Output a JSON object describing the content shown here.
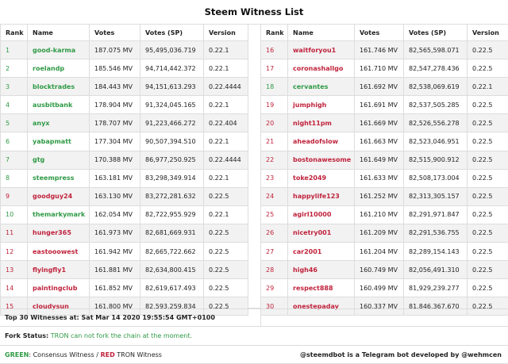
{
  "title": "Steem Witness List",
  "headers": [
    "Rank",
    "Name",
    "Votes",
    "Votes (SP)",
    "Version"
  ],
  "left": [
    {
      "rank": "1",
      "name": "good-karma",
      "votes": "187.075 MV",
      "sp": "95,495,036.719",
      "version": "0.22.1",
      "color": "green"
    },
    {
      "rank": "2",
      "name": "roelandp",
      "votes": "185.546 MV",
      "sp": "94,714,442.372",
      "version": "0.22.1",
      "color": "green"
    },
    {
      "rank": "3",
      "name": "blocktrades",
      "votes": "184.443 MV",
      "sp": "94,151,613.293",
      "version": "0.22.4444",
      "color": "green"
    },
    {
      "rank": "4",
      "name": "ausbitbank",
      "votes": "178.904 MV",
      "sp": "91,324,045.165",
      "version": "0.22.1",
      "color": "green"
    },
    {
      "rank": "5",
      "name": "anyx",
      "votes": "178.707 MV",
      "sp": "91,223,466.272",
      "version": "0.22.404",
      "color": "green"
    },
    {
      "rank": "6",
      "name": "yabapmatt",
      "votes": "177.304 MV",
      "sp": "90,507,394.510",
      "version": "0.22.1",
      "color": "green"
    },
    {
      "rank": "7",
      "name": "gtg",
      "votes": "170.388 MV",
      "sp": "86,977,250.925",
      "version": "0.22.4444",
      "color": "green"
    },
    {
      "rank": "8",
      "name": "steempress",
      "votes": "163.181 MV",
      "sp": "83,298,349.914",
      "version": "0.22.1",
      "color": "green"
    },
    {
      "rank": "9",
      "name": "goodguy24",
      "votes": "163.130 MV",
      "sp": "83,272,281.632",
      "version": "0.22.5",
      "color": "red"
    },
    {
      "rank": "10",
      "name": "themarkymark",
      "votes": "162.054 MV",
      "sp": "82,722,955.929",
      "version": "0.22.1",
      "color": "green"
    },
    {
      "rank": "11",
      "name": "hunger365",
      "votes": "161.973 MV",
      "sp": "82,681,669.931",
      "version": "0.22.5",
      "color": "red"
    },
    {
      "rank": "12",
      "name": "eastooowest",
      "votes": "161.942 MV",
      "sp": "82,665,722.662",
      "version": "0.22.5",
      "color": "red"
    },
    {
      "rank": "13",
      "name": "flyingfly1",
      "votes": "161.881 MV",
      "sp": "82,634,800.415",
      "version": "0.22.5",
      "color": "red"
    },
    {
      "rank": "14",
      "name": "paintingclub",
      "votes": "161.852 MV",
      "sp": "82,619,617.493",
      "version": "0.22.5",
      "color": "red"
    },
    {
      "rank": "15",
      "name": "cloudysun",
      "votes": "161.800 MV",
      "sp": "82,593,259.834",
      "version": "0.22.5",
      "color": "red"
    }
  ],
  "right": [
    {
      "rank": "16",
      "name": "waitforyou1",
      "votes": "161.746 MV",
      "sp": "82,565,598.071",
      "version": "0.22.5",
      "color": "red"
    },
    {
      "rank": "17",
      "name": "coronashallgo",
      "votes": "161.710 MV",
      "sp": "82,547,278.436",
      "version": "0.22.5",
      "color": "red"
    },
    {
      "rank": "18",
      "name": "cervantes",
      "votes": "161.692 MV",
      "sp": "82,538,069.619",
      "version": "0.22.1",
      "color": "green"
    },
    {
      "rank": "19",
      "name": "jumphigh",
      "votes": "161.691 MV",
      "sp": "82,537,505.285",
      "version": "0.22.5",
      "color": "red"
    },
    {
      "rank": "20",
      "name": "night11pm",
      "votes": "161.669 MV",
      "sp": "82,526,556.278",
      "version": "0.22.5",
      "color": "red"
    },
    {
      "rank": "21",
      "name": "aheadofslow",
      "votes": "161.663 MV",
      "sp": "82,523,046.951",
      "version": "0.22.5",
      "color": "red"
    },
    {
      "rank": "22",
      "name": "bostonawesome",
      "votes": "161.649 MV",
      "sp": "82,515,900.912",
      "version": "0.22.5",
      "color": "red"
    },
    {
      "rank": "23",
      "name": "toke2049",
      "votes": "161.633 MV",
      "sp": "82,508,173.004",
      "version": "0.22.5",
      "color": "red"
    },
    {
      "rank": "24",
      "name": "happylife123",
      "votes": "161.252 MV",
      "sp": "82,313,305.157",
      "version": "0.22.5",
      "color": "red"
    },
    {
      "rank": "25",
      "name": "agirl10000",
      "votes": "161.210 MV",
      "sp": "82,291,971.847",
      "version": "0.22.5",
      "color": "red"
    },
    {
      "rank": "26",
      "name": "nicetry001",
      "votes": "161.209 MV",
      "sp": "82,291,536.755",
      "version": "0.22.5",
      "color": "red"
    },
    {
      "rank": "27",
      "name": "car2001",
      "votes": "161.204 MV",
      "sp": "82,289,154.143",
      "version": "0.22.5",
      "color": "red"
    },
    {
      "rank": "28",
      "name": "high46",
      "votes": "160.749 MV",
      "sp": "82,056,491.310",
      "version": "0.22.5",
      "color": "red"
    },
    {
      "rank": "29",
      "name": "respect888",
      "votes": "160.499 MV",
      "sp": "81,929,239.277",
      "version": "0.22.5",
      "color": "red"
    },
    {
      "rank": "30",
      "name": "onestepaday",
      "votes": "160.337 MV",
      "sp": "81,846,367.670",
      "version": "0.22.5",
      "color": "red"
    }
  ],
  "footer": {
    "top30": "Top 30 Witnesses at: Sat Mar 14 2020 19:55:54 GMT+0100",
    "fork_label": "Fork Status:",
    "fork_text": "TRON can not fork the chain at the moment.",
    "legend_green": "GREEN",
    "legend_green_text": ": Consensus Witness / ",
    "legend_red": "RED",
    "legend_red_text": " TRON Witness",
    "credit": "@steemdbot is a Telegram bot developed by @wehmcen"
  },
  "colors": {
    "green": "#2f9a45",
    "red": "#c0233c"
  }
}
